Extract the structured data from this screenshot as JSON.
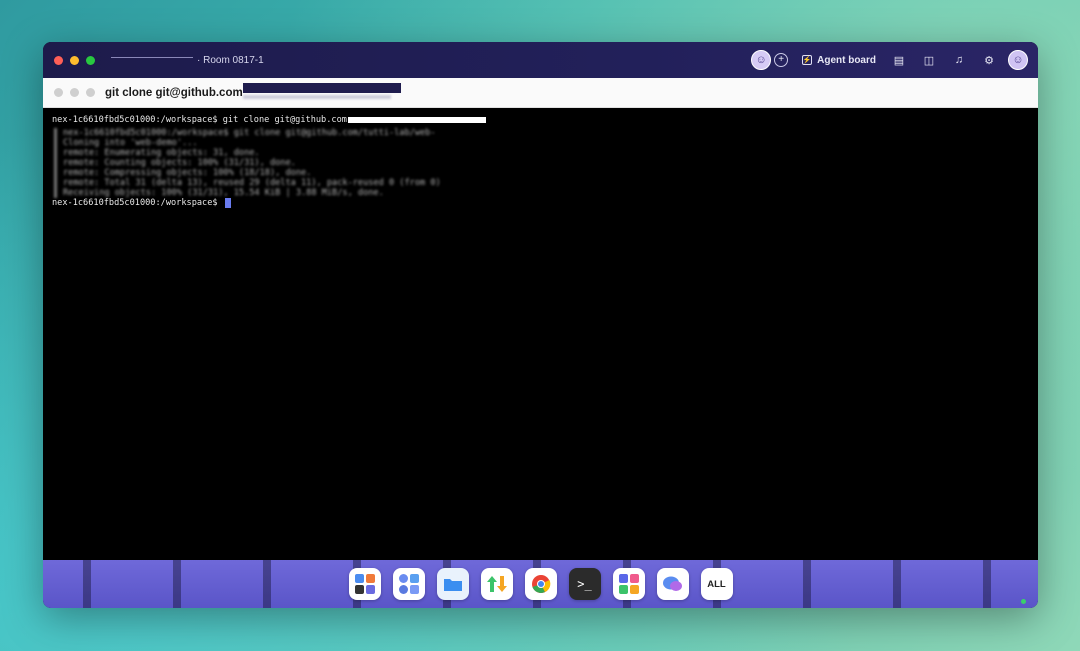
{
  "appbar": {
    "room": "· Room 0817-1",
    "agent_board_label": "Agent board"
  },
  "terminal": {
    "window_title": "git clone git@github.com",
    "prompt_line": "nex-1c6610fbd5c01000:/workspace$ git clone git@github.com",
    "blurred_lines": [
      "nex-1c6610fbd5c01000:/workspace$ git clone git@github.com/tutti-lab/web-",
      "Cloning into 'web-demo'...",
      "remote: Enumerating objects: 31, done.",
      "remote: Counting objects: 100% (31/31), done.",
      "remote: Compressing objects: 100% (18/18), done.",
      "remote: Total 31 (delta 13), reused 29 (delta 11), pack-reused 0 (from 0)",
      "Receiving objects: 100% (31/31), 15.54 KiB | 3.88 MiB/s, done."
    ],
    "current_prompt": "nex-1c6610fbd5c01000:/workspace$ "
  },
  "dock": {
    "all_label": "ALL"
  },
  "colors": {
    "appbar_bg": "#1d1b4b",
    "cursor": "#6a7cf0",
    "dock_bg": "#6f69d9"
  }
}
